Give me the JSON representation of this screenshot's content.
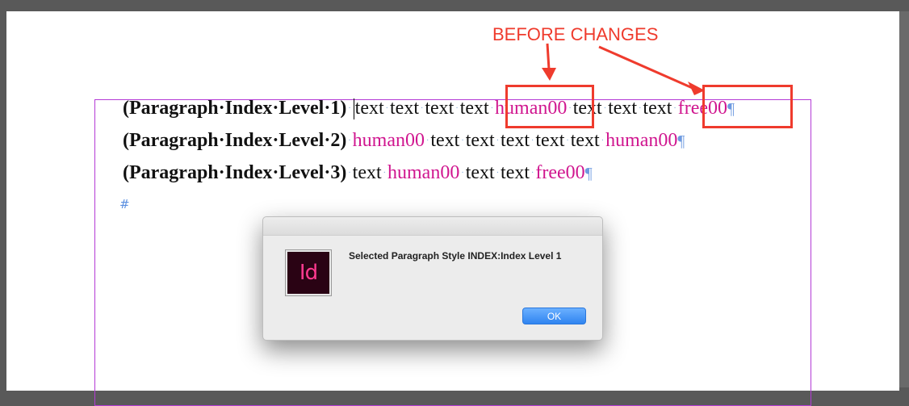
{
  "document": {
    "lines": [
      {
        "style": "(Paragraph·Index·Level·1)",
        "words": [
          "text",
          "text",
          "text",
          "text"
        ],
        "tag1": "human00",
        "words2": [
          "text",
          "text",
          "text"
        ],
        "tag2": "free00"
      },
      {
        "style": "(Paragraph·Index·Level·2)",
        "tag1": "human00",
        "words": [
          "text",
          "text",
          "text",
          "text",
          "text"
        ],
        "tag2": "human00"
      },
      {
        "style": "(Paragraph·Index·Level·3)",
        "words": [
          "text"
        ],
        "tag1": "human00",
        "words2": [
          "text",
          "text"
        ],
        "tag2": "free00"
      }
    ],
    "pilcrow": "¶",
    "end_marker": "#",
    "space_dot": "·"
  },
  "annotation": {
    "label": "BEFORE CHANGES",
    "color": "#ef3b2d"
  },
  "dialog": {
    "app_icon_text": "Id",
    "message": "Selected Paragraph Style INDEX:Index Level 1",
    "ok_label": "OK"
  }
}
